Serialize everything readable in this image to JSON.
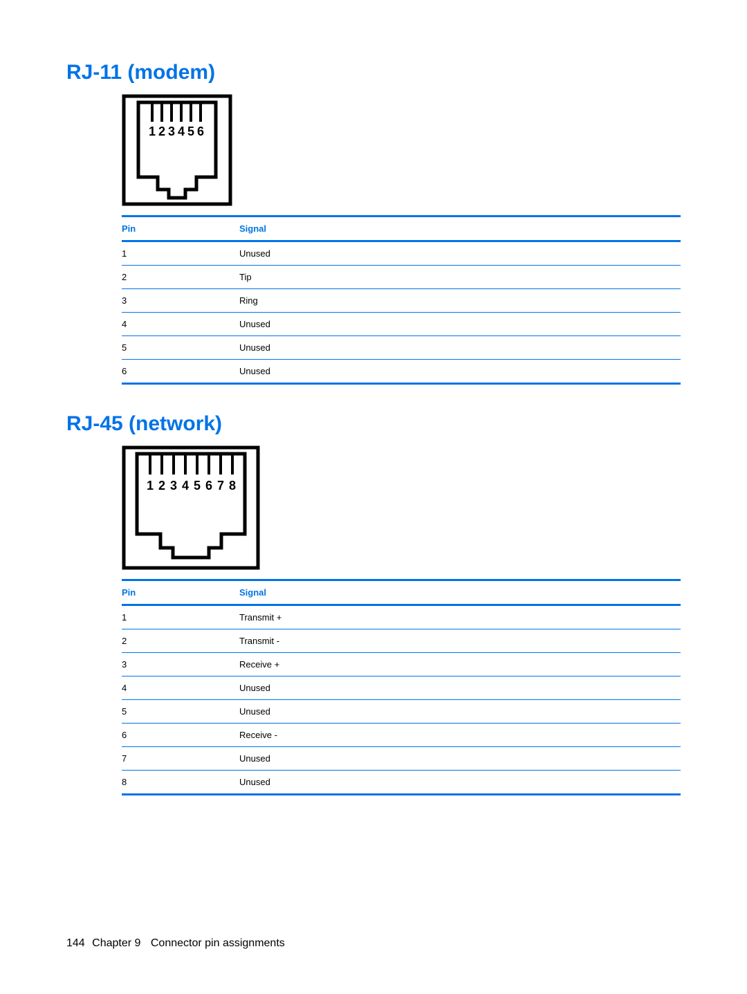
{
  "sections": [
    {
      "heading": "RJ-11 (modem)",
      "diagram": {
        "type": "rj11",
        "labels": [
          "1",
          "2",
          "3",
          "4",
          "5",
          "6"
        ]
      },
      "table": {
        "headers": {
          "pin": "Pin",
          "signal": "Signal"
        },
        "rows": [
          {
            "pin": "1",
            "signal": "Unused"
          },
          {
            "pin": "2",
            "signal": "Tip"
          },
          {
            "pin": "3",
            "signal": "Ring"
          },
          {
            "pin": "4",
            "signal": "Unused"
          },
          {
            "pin": "5",
            "signal": "Unused"
          },
          {
            "pin": "6",
            "signal": "Unused"
          }
        ]
      }
    },
    {
      "heading": "RJ-45 (network)",
      "diagram": {
        "type": "rj45",
        "labels": [
          "1",
          "2",
          "3",
          "4",
          "5",
          "6",
          "7",
          "8"
        ]
      },
      "table": {
        "headers": {
          "pin": "Pin",
          "signal": "Signal"
        },
        "rows": [
          {
            "pin": "1",
            "signal": "Transmit +"
          },
          {
            "pin": "2",
            "signal": "Transmit -"
          },
          {
            "pin": "3",
            "signal": "Receive +"
          },
          {
            "pin": "4",
            "signal": "Unused"
          },
          {
            "pin": "5",
            "signal": "Unused"
          },
          {
            "pin": "6",
            "signal": "Receive -"
          },
          {
            "pin": "7",
            "signal": "Unused"
          },
          {
            "pin": "8",
            "signal": "Unused"
          }
        ]
      }
    }
  ],
  "footer": {
    "page": "144",
    "chapter_label": "Chapter 9",
    "chapter_title": "Connector pin assignments"
  }
}
